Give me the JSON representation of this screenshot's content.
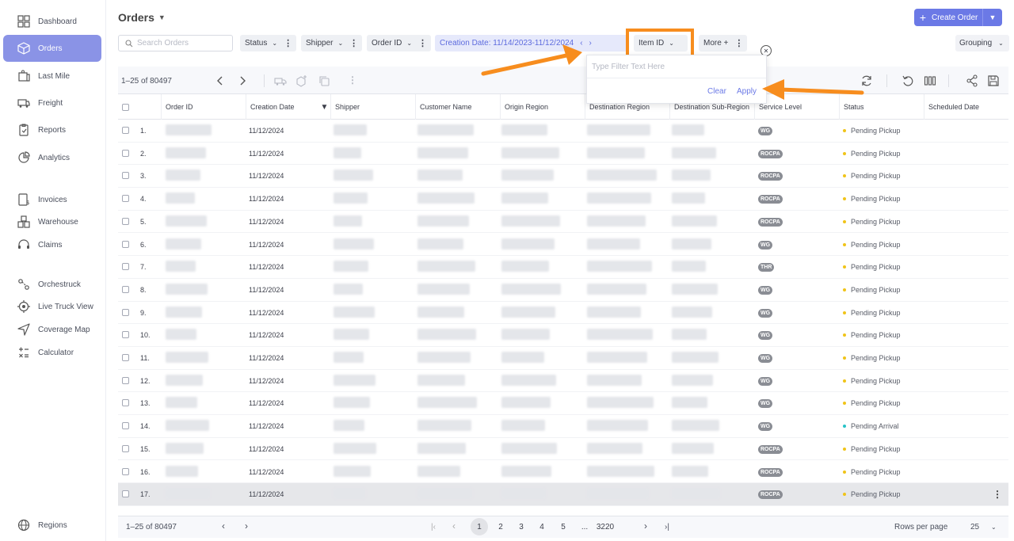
{
  "sidebar": {
    "items": [
      {
        "label": "Dashboard",
        "icon": "dashboard-icon"
      },
      {
        "label": "Orders",
        "icon": "box-icon",
        "active": true
      },
      {
        "label": "Last Mile",
        "icon": "package-icon"
      },
      {
        "label": "Freight",
        "icon": "truck-icon"
      },
      {
        "label": "Reports",
        "icon": "reports-icon"
      },
      {
        "label": "Analytics",
        "icon": "analytics-icon"
      },
      {
        "label": "Invoices",
        "icon": "invoice-icon"
      },
      {
        "label": "Warehouse",
        "icon": "warehouse-icon"
      },
      {
        "label": "Claims",
        "icon": "headset-icon"
      },
      {
        "label": "Orchestruck",
        "icon": "route-icon"
      },
      {
        "label": "Live Truck View",
        "icon": "target-icon"
      },
      {
        "label": "Coverage Map",
        "icon": "navigation-icon"
      },
      {
        "label": "Calculator",
        "icon": "calculator-icon"
      }
    ],
    "regions_label": "Regions"
  },
  "header": {
    "title": "Orders",
    "create_label": "Create Order"
  },
  "filters": {
    "search_placeholder": "Search Orders",
    "status": "Status",
    "shipper": "Shipper",
    "order_id": "Order ID",
    "creation_date": "Creation Date: 11/14/2023-11/12/2024",
    "item_id": "Item ID",
    "more": "More +",
    "grouping": "Grouping"
  },
  "popup": {
    "placeholder": "Type Filter Text Here",
    "clear": "Clear",
    "apply": "Apply"
  },
  "toolbar": {
    "range": "1–25 of 80497"
  },
  "table": {
    "columns": [
      "Order ID",
      "Creation Date",
      "Shipper",
      "Customer Name",
      "Origin Region",
      "Destination Region",
      "Destination Sub-Region",
      "Service Level",
      "Status",
      "Scheduled Date"
    ],
    "rows": [
      {
        "n": "1.",
        "date": "11/12/2024",
        "service": "WG",
        "status": "Pending Pickup"
      },
      {
        "n": "2.",
        "date": "11/12/2024",
        "service": "ROCPA",
        "status": "Pending Pickup"
      },
      {
        "n": "3.",
        "date": "11/12/2024",
        "service": "ROCPA",
        "status": "Pending Pickup"
      },
      {
        "n": "4.",
        "date": "11/12/2024",
        "service": "ROCPA",
        "status": "Pending Pickup"
      },
      {
        "n": "5.",
        "date": "11/12/2024",
        "service": "ROCPA",
        "status": "Pending Pickup"
      },
      {
        "n": "6.",
        "date": "11/12/2024",
        "service": "WG",
        "status": "Pending Pickup"
      },
      {
        "n": "7.",
        "date": "11/12/2024",
        "service": "THR",
        "status": "Pending Pickup"
      },
      {
        "n": "8.",
        "date": "11/12/2024",
        "service": "WG",
        "status": "Pending Pickup"
      },
      {
        "n": "9.",
        "date": "11/12/2024",
        "service": "WG",
        "status": "Pending Pickup"
      },
      {
        "n": "10.",
        "date": "11/12/2024",
        "service": "WG",
        "status": "Pending Pickup"
      },
      {
        "n": "11.",
        "date": "11/12/2024",
        "service": "WG",
        "status": "Pending Pickup"
      },
      {
        "n": "12.",
        "date": "11/12/2024",
        "service": "WG",
        "status": "Pending Pickup"
      },
      {
        "n": "13.",
        "date": "11/12/2024",
        "service": "WG",
        "status": "Pending Pickup"
      },
      {
        "n": "14.",
        "date": "11/12/2024",
        "service": "WG",
        "status": "Pending Arrival"
      },
      {
        "n": "15.",
        "date": "11/12/2024",
        "service": "ROCPA",
        "status": "Pending Pickup"
      },
      {
        "n": "16.",
        "date": "11/12/2024",
        "service": "ROCPA",
        "status": "Pending Pickup"
      },
      {
        "n": "17.",
        "date": "11/12/2024",
        "service": "ROCPA",
        "status": "Pending Pickup"
      }
    ]
  },
  "footer": {
    "range": "1–25 of 80497",
    "pages": [
      "1",
      "2",
      "3",
      "4",
      "5",
      "...",
      "3220"
    ],
    "rows_per_page_label": "Rows per page",
    "rows_per_page": "25"
  },
  "colors": {
    "accent": "#6b79e6",
    "highlight": "#f78d1e",
    "pending_pickup": "#f0c419",
    "pending_arrival": "#27c3c7"
  }
}
